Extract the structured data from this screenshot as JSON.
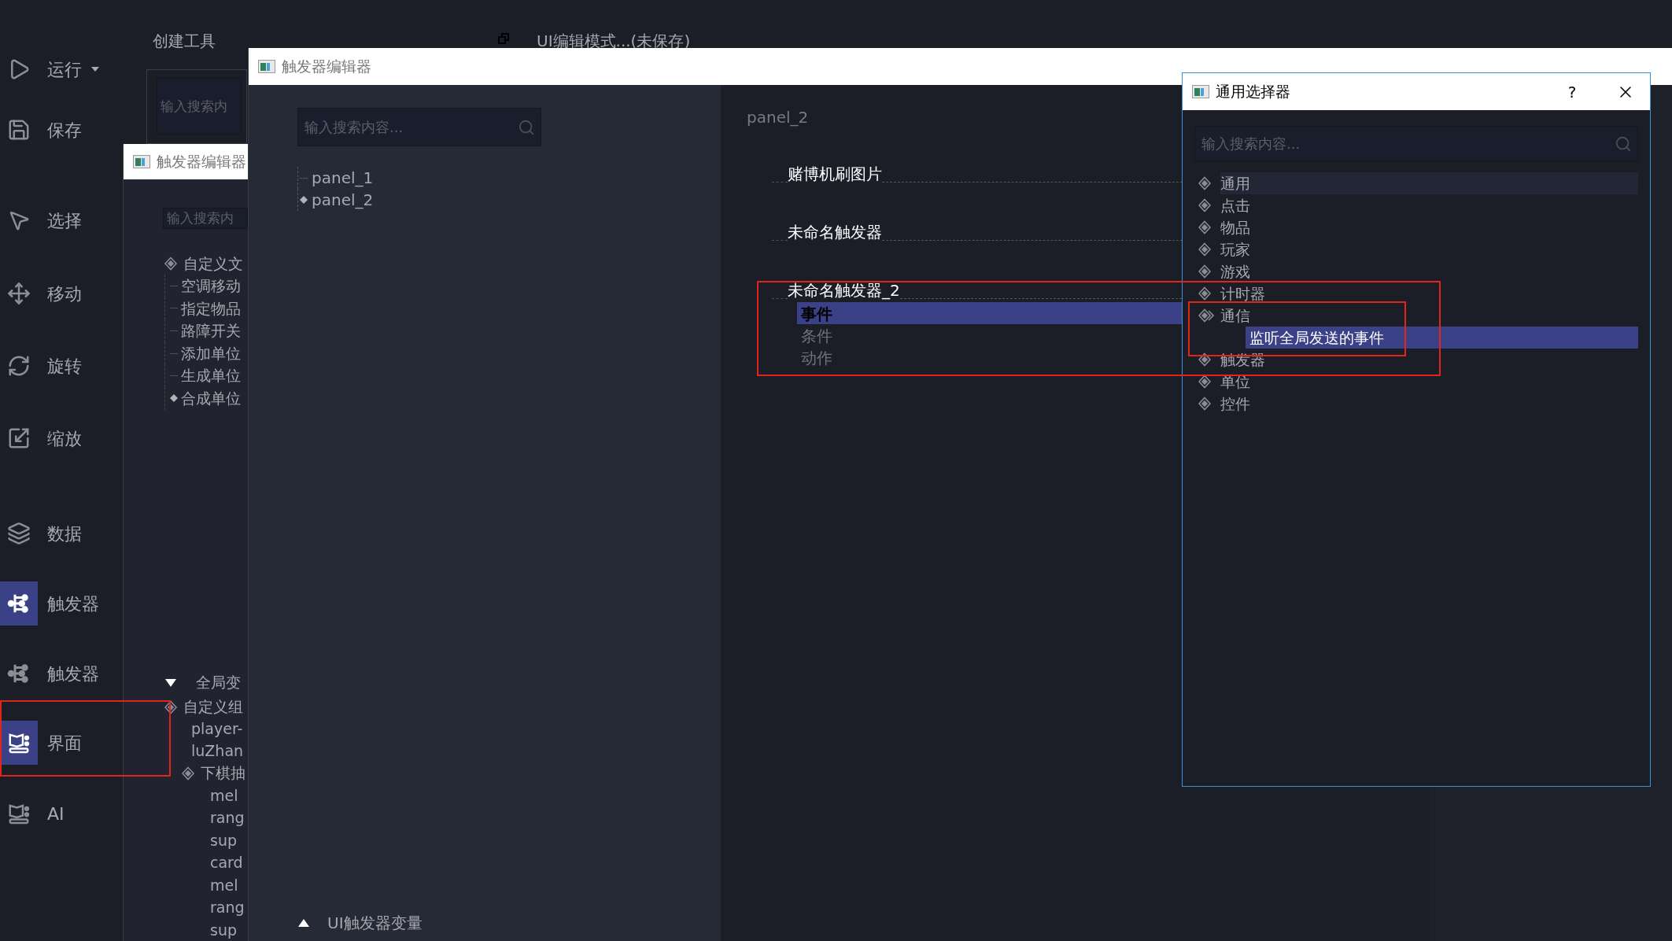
{
  "sidebar": {
    "items": [
      {
        "label": "运行",
        "selected": false,
        "has_menu": true
      },
      {
        "label": "保存",
        "selected": false,
        "has_menu": false
      },
      {
        "label": "选择",
        "selected": false,
        "has_menu": false
      },
      {
        "label": "移动",
        "selected": false,
        "has_menu": false
      },
      {
        "label": "旋转",
        "selected": false,
        "has_menu": false
      },
      {
        "label": "缩放",
        "selected": false,
        "has_menu": false
      },
      {
        "label": "数据",
        "selected": false,
        "has_menu": false
      },
      {
        "label": "触发器",
        "selected": true,
        "has_menu": false
      },
      {
        "label": "触发器",
        "selected": false,
        "has_menu": false
      },
      {
        "label": "界面",
        "selected": true,
        "has_menu": false
      },
      {
        "label": "AI",
        "selected": false,
        "has_menu": false
      }
    ]
  },
  "create_tools": {
    "title": "创建工具",
    "search": {
      "placeholder": "输入搜索内"
    }
  },
  "mode_label": "UI编辑模式...(未保存)",
  "back_window": {
    "title": "触发器编辑器",
    "search": {
      "placeholder": "输入搜索内"
    },
    "tree": [
      {
        "label": "自定义文",
        "children": [
          {
            "label": "空调移动",
            "selected": false
          },
          {
            "label": "指定物品",
            "selected": false
          },
          {
            "label": "路障开关",
            "selected": false
          },
          {
            "label": "添加单位",
            "selected": false
          },
          {
            "label": "生成单位",
            "selected": false
          },
          {
            "label": "合成单位",
            "selected": true
          }
        ]
      }
    ],
    "variables": {
      "label": "全局变",
      "expanded": true,
      "tree": [
        {
          "label": "自定义组",
          "children": [
            {
              "label": "player-"
            },
            {
              "label": "luZhan"
            },
            {
              "label": "下棋抽",
              "children": [
                {
                  "label": "mel"
                },
                {
                  "label": "rang"
                },
                {
                  "label": "sup"
                },
                {
                  "label": "card"
                },
                {
                  "label": "mel"
                },
                {
                  "label": "rang"
                },
                {
                  "label": "sup"
                }
              ]
            }
          ]
        }
      ]
    }
  },
  "trigger_editor": {
    "title": "触发器编辑器",
    "search": {
      "placeholder": "输入搜索内容..."
    },
    "panels": [
      {
        "label": "panel_1",
        "selected": false
      },
      {
        "label": "panel_2",
        "selected": true
      }
    ],
    "variables": {
      "label": "UI触发器变量",
      "expanded": false
    },
    "detail": {
      "heading": "panel_2",
      "triggers": [
        {
          "label": "赌博机刷图片"
        },
        {
          "label": "未命名触发器"
        },
        {
          "label": "未命名触发器_2",
          "children": [
            {
              "label": "事件",
              "selected": true
            },
            {
              "label": "条件",
              "selected": false
            },
            {
              "label": "动作",
              "selected": false
            }
          ]
        }
      ]
    }
  },
  "selector_dialog": {
    "title": "通用选择器",
    "help": "?",
    "search": {
      "placeholder": "输入搜索内容..."
    },
    "categories": [
      {
        "label": "通用",
        "hovered": true,
        "expanded": false
      },
      {
        "label": "点击",
        "hovered": false,
        "expanded": false
      },
      {
        "label": "物品",
        "hovered": false,
        "expanded": false
      },
      {
        "label": "玩家",
        "hovered": false,
        "expanded": false
      },
      {
        "label": "游戏",
        "hovered": false,
        "expanded": false
      },
      {
        "label": "计时器",
        "hovered": false,
        "expanded": false
      },
      {
        "label": "通信",
        "hovered": false,
        "expanded": true,
        "children": [
          {
            "label": "监听全局发送的事件",
            "selected": true
          }
        ]
      },
      {
        "label": "触发器",
        "hovered": false,
        "expanded": false
      },
      {
        "label": "单位",
        "hovered": false,
        "expanded": false
      },
      {
        "label": "控件",
        "hovered": false,
        "expanded": false
      }
    ]
  }
}
